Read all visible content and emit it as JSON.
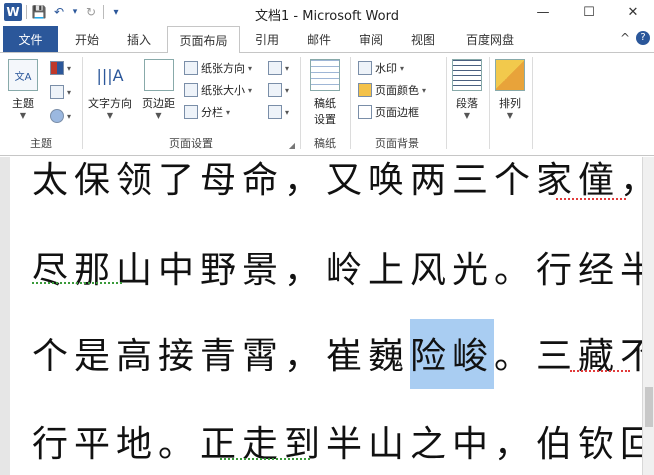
{
  "app": {
    "title": "文档1 - Microsoft Word",
    "logo_letter": "W"
  },
  "window_controls": {
    "minimize": "—",
    "maximize": "☐",
    "close": "✕"
  },
  "qat": {
    "save": "💾",
    "undo": "↶",
    "redo": "↻",
    "menu": "▾"
  },
  "tabs": [
    {
      "label": "文件"
    },
    {
      "label": "开始"
    },
    {
      "label": "插入"
    },
    {
      "label": "页面布局"
    },
    {
      "label": "引用"
    },
    {
      "label": "邮件"
    },
    {
      "label": "审阅"
    },
    {
      "label": "视图"
    },
    {
      "label": "百度网盘"
    }
  ],
  "active_tab": "页面布局",
  "tab_right": {
    "collapse": "^",
    "help": "?"
  },
  "ribbon": {
    "theme_group": {
      "label": "主题",
      "theme_button": "主题"
    },
    "page_setup_group": {
      "label": "页面设置",
      "text_direction": "文字方向",
      "margins": "页边距",
      "orientation": "纸张方向",
      "size": "纸张大小",
      "columns": "分栏"
    },
    "draft_group": {
      "label": "稿纸",
      "draft_settings_line1": "稿纸",
      "draft_settings_line2": "设置"
    },
    "page_background_group": {
      "label": "页面背景",
      "watermark": "水印",
      "page_color": "页面颜色",
      "page_borders": "页面边框"
    },
    "paragraph_button": "段落",
    "arrange_button": "排列"
  },
  "document": {
    "lines": [
      {
        "before": "太保领了母命，又唤两三个家僮，各",
        "highlight": "",
        "after": ""
      },
      {
        "before": "尽那山中野景，岭上风光。行经半日",
        "highlight": "",
        "after": ""
      },
      {
        "before": "个是高接青霄，崔巍",
        "highlight": "险峻",
        "after": "。三藏不一"
      },
      {
        "before": "行平地。正走到半山之中，伯钦回身",
        "highlight": "",
        "after": ""
      }
    ]
  },
  "colors": {
    "accent": "#2b579a",
    "selection": "#a9cdf2",
    "spell_error": "#e23b3b",
    "grammar_error": "#3a9a3a"
  }
}
